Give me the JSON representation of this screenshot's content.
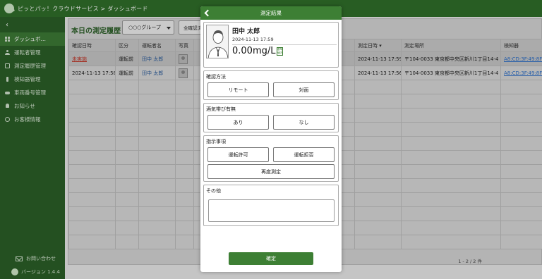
{
  "header": {
    "breadcrumb": "ピッとパッ！クラウドサービス > ダッシュボード"
  },
  "sidebar": {
    "collapse_glyph": "‹",
    "items": [
      {
        "label": "ダッシュボ…",
        "icon": "dashboard-icon"
      },
      {
        "label": "運転者管理",
        "icon": "driver-icon"
      },
      {
        "label": "測定履歴管理",
        "icon": "document-icon"
      },
      {
        "label": "検知器管理",
        "icon": "probe-icon"
      },
      {
        "label": "車両番号管理",
        "icon": "car-icon"
      },
      {
        "label": "お知らせ",
        "icon": "bell-icon"
      },
      {
        "label": "お客様情報",
        "icon": "info-icon"
      }
    ],
    "contact": "お問い合わせ",
    "version": "バージョン 1.4.4"
  },
  "main": {
    "title": "本日の測定履歴",
    "group_select": "○○○グループ",
    "confirm_button": "全確認済",
    "columns": [
      "確認日時",
      "区分",
      "運転者名",
      "写真",
      "",
      "",
      "",
      "",
      "測定日時 ▾",
      "測定場所",
      "検知器"
    ],
    "rows": [
      {
        "confirm": "未実施",
        "kubun": "運転前",
        "driver": "田中 太郎",
        "measured": "2024-11-13 17:59",
        "place": "〒104-0033 東京都中央区新川1丁目14-4",
        "device": "A8:CD:3F:49:8F:6"
      },
      {
        "confirm": "2024-11-13 17:58",
        "kubun": "運転前",
        "driver": "田中 太郎",
        "measured": "2024-11-13 17:56",
        "place": "〒104-0033 東京都中央区新川1丁目14-4",
        "device": "A8:CD:3F:49:8F:6"
      }
    ],
    "pagination": "1 - 2 / 2 件"
  },
  "modal": {
    "title": "測定結果",
    "name": "田中 太郎",
    "datetime": "2024-11-13 17:59",
    "value": "0.00mg/L",
    "stamp": "基準値内",
    "method": {
      "label": "確認方法",
      "options": [
        "リモート",
        "対面"
      ]
    },
    "alcohol": {
      "label": "酒気帯び有無",
      "options": [
        "あり",
        "なし"
      ]
    },
    "instruction": {
      "label": "指示事項",
      "options": [
        "運転許可",
        "運転拒否",
        "再度測定"
      ]
    },
    "other": {
      "label": "その他",
      "value": ""
    },
    "confirm": "確定"
  },
  "colors": {
    "brand": "#2f6e2a",
    "accent": "#3d7f34",
    "warning": "#c0392b",
    "link": "#2e6fc7"
  }
}
